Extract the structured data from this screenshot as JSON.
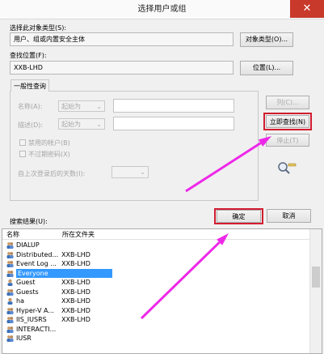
{
  "window": {
    "title": "选择用户或组",
    "close_glyph": "✕"
  },
  "object_type": {
    "label": "选择此对象类型(S):",
    "value": "用户、组或内置安全主体",
    "button": "对象类型(O)..."
  },
  "location": {
    "label": "查找位置(F):",
    "value": "XXB-LHD",
    "button": "位置(L)..."
  },
  "general_query": {
    "tab": "一般性查询",
    "name_label": "名称(A):",
    "desc_label": "描述(D):",
    "starts_with": "起始为",
    "disabled_accounts": "禁用的帐户(B)",
    "non_expiring": "不过期密码(X)",
    "days_label": "自上次登录后的天数(I):"
  },
  "side_buttons": {
    "columns": "列(C)...",
    "find_now": "立即查找(N)",
    "stop": "停止(T)"
  },
  "dialog_buttons": {
    "ok": "确定",
    "cancel": "取消"
  },
  "results": {
    "label": "搜索结果(U):",
    "columns": [
      "名称",
      "所在文件夹"
    ],
    "rows": [
      {
        "name": "DIALUP",
        "folder": "",
        "icon": "group-icon"
      },
      {
        "name": "Distributed...",
        "folder": "XXB-LHD",
        "icon": "group-icon"
      },
      {
        "name": "Event Log ...",
        "folder": "XXB-LHD",
        "icon": "group-icon"
      },
      {
        "name": "Everyone",
        "folder": "",
        "icon": "group-icon",
        "selected": true
      },
      {
        "name": "Guest",
        "folder": "XXB-LHD",
        "icon": "user-icon"
      },
      {
        "name": "Guests",
        "folder": "XXB-LHD",
        "icon": "group-icon"
      },
      {
        "name": "ha",
        "folder": "XXB-LHD",
        "icon": "user-icon"
      },
      {
        "name": "Hyper-V A...",
        "folder": "XXB-LHD",
        "icon": "group-icon"
      },
      {
        "name": "IIS_IUSRS",
        "folder": "XXB-LHD",
        "icon": "group-icon"
      },
      {
        "name": "INTERACTI...",
        "folder": "",
        "icon": "group-icon"
      },
      {
        "name": "IUSR",
        "folder": "",
        "icon": "group-icon"
      }
    ]
  },
  "colors": {
    "highlight_box": "#d21c30",
    "arrow": "#ee28e8",
    "selection": "#3399ff"
  }
}
